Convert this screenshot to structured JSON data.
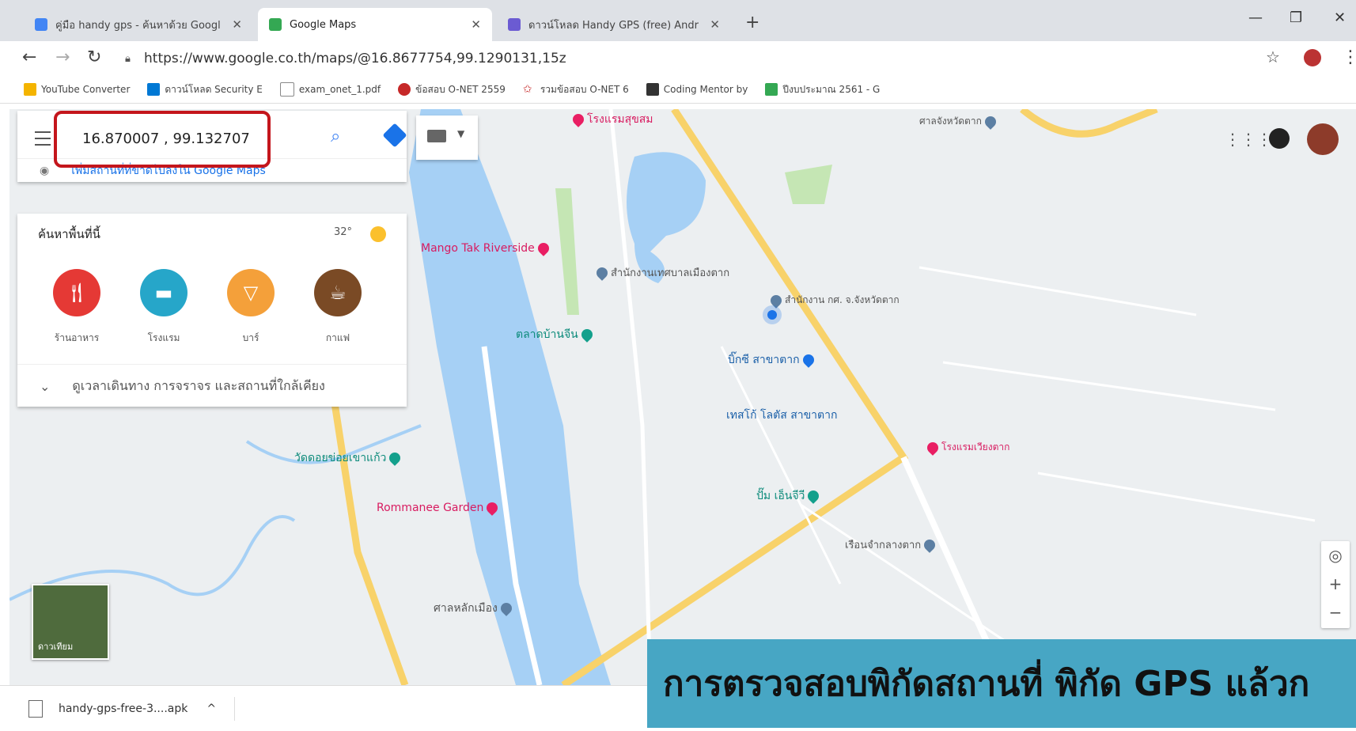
{
  "browser": {
    "tabs": [
      {
        "title": "คู่มือ handy gps - ค้นหาด้วย Googl",
        "active": false
      },
      {
        "title": "Google Maps",
        "active": true
      },
      {
        "title": "ดาวน์โหลด Handy GPS (free) Andr",
        "active": false
      }
    ],
    "url": "https://www.google.co.th/maps/@16.8677754,99.1290131,15z",
    "bookmarks": [
      "YouTube Converter",
      "ดาวน์โหลด Security E",
      "exam_onet_1.pdf",
      "ข้อสอบ O-NET 2559",
      "รวมข้อสอบ O-NET 6",
      "Coding Mentor by",
      "ปีงบประมาณ 2561 - G"
    ]
  },
  "maps": {
    "search_value": "16.870007 , 99.132707",
    "suggestion": "เพิ่มสถานที่ที่ขาดไปลงใน Google Maps",
    "explore": {
      "title": "ค้นหาพื้นที่นี้",
      "temperature": "32°",
      "categories": [
        {
          "label": "ร้านอาหาร",
          "icon": "restaurant-icon",
          "color": "#e53935"
        },
        {
          "label": "โรงแรม",
          "icon": "hotel-icon",
          "color": "#26a6c9"
        },
        {
          "label": "บาร์",
          "icon": "bar-icon",
          "color": "#f4a03a"
        },
        {
          "label": "กาแฟ",
          "icon": "coffee-icon",
          "color": "#7a4a25"
        }
      ],
      "footer": "ดูเวลาเดินทาง การจราจร และสถานที่ใกล้เคียง"
    },
    "places": [
      "โรงแรมสุขสม",
      "Mango Tak Riverside",
      "สำนักงานเทศบาลเมืองตาก",
      "สำนักงาน กศ. จ.จังหวัดตาก",
      "บิ๊กซี สาขาตาก",
      "เทสโก้ โลตัส สาขาตาก",
      "ตลาดบ้านจีน",
      "วัดดอยข่อยเขาแก้ว",
      "Rommanee Garden",
      "ปั๊ม เอ็นจีวี",
      "เรือนจำกลางตาก",
      "ศาลหลักเมือง",
      "โรงแรมเวียงตาก",
      "ศาลจังหวัดตาก"
    ],
    "satellite_label": "ดาวเทียม"
  },
  "downloads": {
    "file": "handy-gps-free-3....apk"
  },
  "caption": "การตรวจสอบพิกัดสถานที่ พิกัด GPS แล้วก"
}
